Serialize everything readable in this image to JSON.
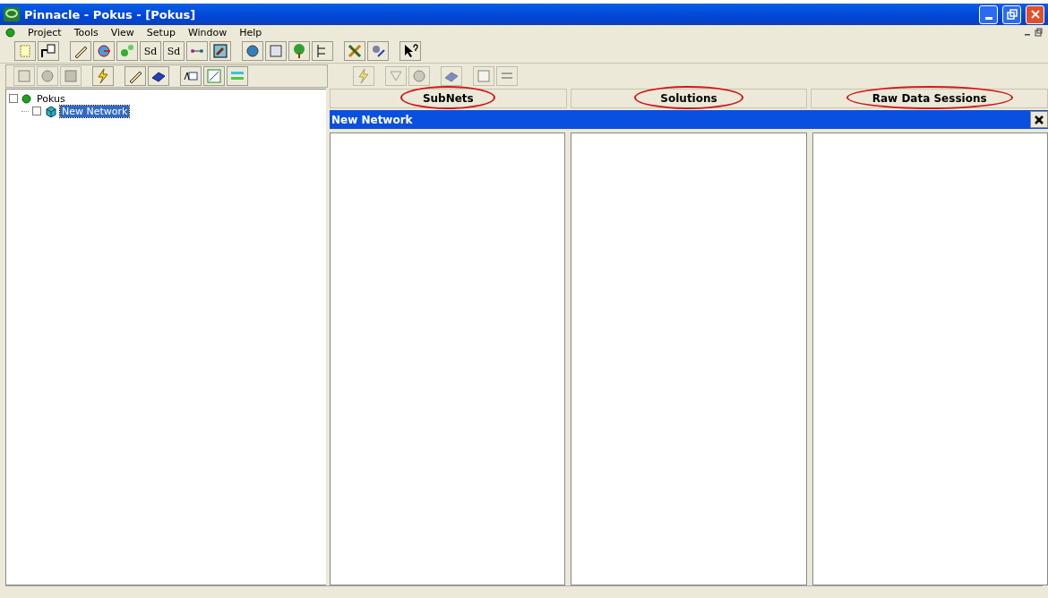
{
  "window": {
    "title": "Pinnacle - Pokus - [Pokus]"
  },
  "menu": [
    "Project",
    "Tools",
    "View",
    "Setup",
    "Window",
    "Help"
  ],
  "toolbar_texts": [
    "Sd",
    "Sd"
  ],
  "tree": [
    {
      "label": "Pokus",
      "checked": false,
      "selected": false,
      "children": [
        {
          "label": "New Network",
          "checked": false,
          "selected": true
        }
      ]
    }
  ],
  "tabs": [
    {
      "label": "SubNets",
      "circled": true
    },
    {
      "label": "Solutions",
      "circled": true
    },
    {
      "label": "Raw Data Sessions",
      "circled": true
    }
  ],
  "network_bar": {
    "title": "New Network"
  }
}
